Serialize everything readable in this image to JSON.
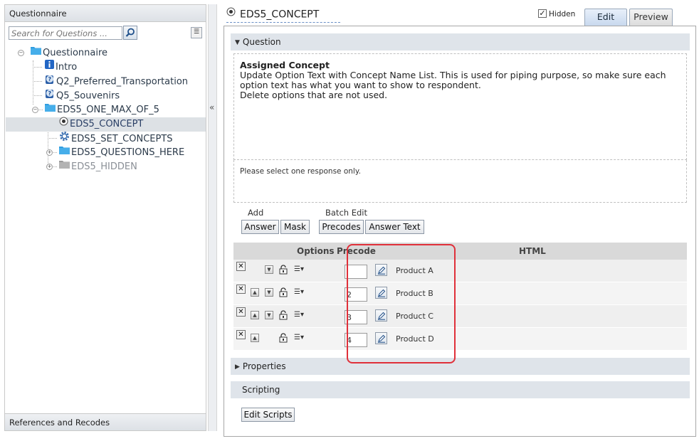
{
  "left_panel": {
    "header": "Questionnaire",
    "search": {
      "placeholder": "Search for Questions ..."
    },
    "footer": "References and Recodes"
  },
  "tree": {
    "root": "Questionnaire",
    "intro": "Intro",
    "q2": "Q2_Preferred_Transportation",
    "q5": "Q5_Souvenirs",
    "block": "EDS5_ONE_MAX_OF_5",
    "concept": "EDS5_CONCEPT",
    "set_concepts": "EDS5_SET_CONCEPTS",
    "questions_here": "EDS5_QUESTIONS_HERE",
    "hidden": "EDS5_HIDDEN"
  },
  "header": {
    "title": "EDS5_CONCEPT",
    "hidden_label": "Hidden",
    "hidden_checked": true,
    "tabs": [
      "Edit",
      "Preview"
    ],
    "active_tab": "Edit"
  },
  "question": {
    "section_label": "Question",
    "heading": "Assigned Concept",
    "lines": [
      "Update Option Text with Concept Name List. This is used for piping purpose, so make sure each",
      "option text has what you want to show to respondent.",
      "Delete options that are not used."
    ],
    "instruction": "Please select one response only."
  },
  "toolbar": {
    "add_label": "Add",
    "batch_edit_label": "Batch Edit",
    "answer_btn": "Answer",
    "mask_btn": "Mask",
    "precodes_btn": "Precodes",
    "answer_text_btn": "Answer Text"
  },
  "grid": {
    "headers": {
      "options": "Options",
      "precode": "Precode",
      "html": "HTML"
    },
    "rows": [
      {
        "precode": "",
        "text": "Product A"
      },
      {
        "precode": "2",
        "text": "Product B"
      },
      {
        "precode": "3",
        "text": "Product C"
      },
      {
        "precode": "4",
        "text": "Product D"
      }
    ]
  },
  "properties": {
    "label": "Properties"
  },
  "scripting": {
    "label": "Scripting",
    "edit_btn": "Edit Scripts"
  },
  "colors": {
    "highlight": "#e0303a",
    "section_bar": "#dfe4ea",
    "folder": "#3aa3e0"
  },
  "icons": [
    "search-icon",
    "filter-icon",
    "folder-icon",
    "info-icon",
    "question-icon",
    "radio-icon",
    "gear-icon",
    "lock-icon",
    "edit-icon",
    "close-icon",
    "chevron-icon"
  ]
}
